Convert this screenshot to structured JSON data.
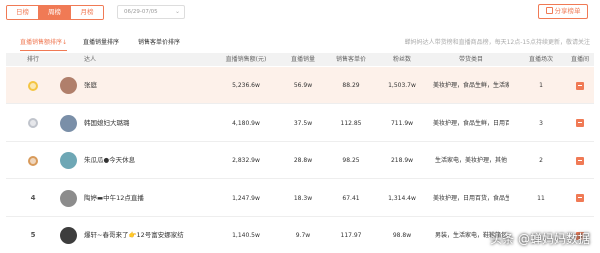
{
  "top": {
    "tabs": [
      "日榜",
      "周榜",
      "月榜"
    ],
    "date_range": "06/29-07/05",
    "share_label": "分享榜单"
  },
  "subtabs": [
    "直播销售额排序↓",
    "直播销量排序",
    "销售客单价排序"
  ],
  "notice": "蝉妈妈达人带货榜和直播商品榜，每天12点-15点持续更新，敬请关注",
  "headers": [
    "排行",
    "达人",
    "直播销售额(元)",
    "直播销量",
    "销售客单价",
    "粉丝数",
    "带货类目",
    "直播场次",
    "直播间"
  ],
  "medal_colors": {
    "gold": "#f4c542",
    "silver": "#c0c4cc",
    "bronze": "#d89a5a",
    "accent": "#f07a55"
  },
  "rows": [
    {
      "rank": "",
      "medal": "gold",
      "name": "张庭",
      "sales": "5,236.6w",
      "volume": "56.9w",
      "price": "88.29",
      "fans": "1,503.7w",
      "category": "美妆护理，食品生鲜，生活家电",
      "sessions": "1",
      "avatar_color": "#b07f6b"
    },
    {
      "rank": "",
      "medal": "silver",
      "name": "韩国媳妇大璐璐",
      "sales": "4,180.9w",
      "volume": "37.5w",
      "price": "112.85",
      "fans": "711.9w",
      "category": "美妆护理，食品生鲜，日用百货",
      "sessions": "3",
      "avatar_color": "#7a8fa8"
    },
    {
      "rank": "",
      "medal": "bronze",
      "name": "朱瓜瓜●今天休息",
      "sales": "2,832.9w",
      "volume": "28.8w",
      "price": "98.25",
      "fans": "218.9w",
      "category": "生活家电，美妆护理，其他",
      "sessions": "2",
      "avatar_color": "#6ea7b5"
    },
    {
      "rank": "4",
      "medal": "",
      "name": "陶婷▬中午12点直播",
      "sales": "1,247.9w",
      "volume": "18.3w",
      "price": "67.41",
      "fans": "1,314.4w",
      "category": "美妆护理，日用百货，食品生鲜",
      "sessions": "11",
      "avatar_color": "#8c8c8c"
    },
    {
      "rank": "5",
      "medal": "",
      "name": "爆轩~春哥来了👉12号富安娜家纺",
      "sales": "1,140.5w",
      "volume": "9.7w",
      "price": "117.97",
      "fans": "98.8w",
      "category": "男装，生活家电，鞋靴箱包",
      "sessions": "",
      "avatar_color": "#3d3d3d"
    }
  ],
  "watermark": "头条 @蝉妈妈数据"
}
